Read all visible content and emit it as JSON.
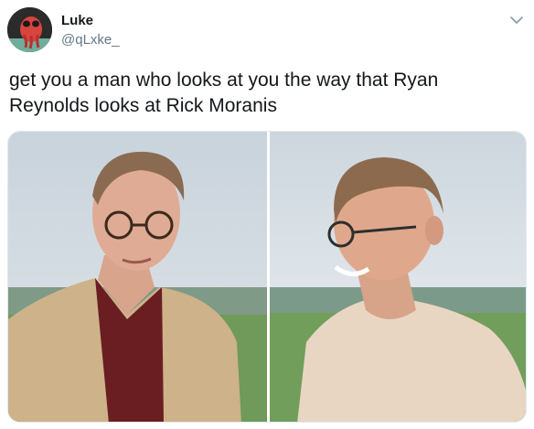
{
  "user": {
    "display_name": "Luke",
    "handle": "@qLxke_",
    "avatar_icon": "zoidberg-avatar-icon"
  },
  "tweet": {
    "text": "get you a man who looks at you the way that Ryan\nReynolds looks at Rick Moranis"
  },
  "menu": {
    "icon": "chevron-down-icon"
  },
  "media": {
    "photos": [
      {
        "icon": "man-glasses-tan-jacket-photo"
      },
      {
        "icon": "smiling-man-cream-shirt-photo"
      }
    ]
  },
  "colors": {
    "text": "#14171a",
    "secondary": "#657786",
    "border": "#e1e8ed"
  }
}
